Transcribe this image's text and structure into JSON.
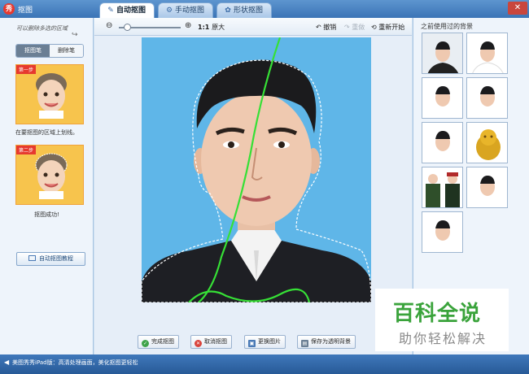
{
  "window": {
    "title": "抠图",
    "close_symbol": "✕"
  },
  "tabs": [
    {
      "label": "自动抠图",
      "icon": "brush-icon",
      "active": true
    },
    {
      "label": "手动抠图",
      "icon": "gear-icon",
      "active": false
    },
    {
      "label": "形状抠图",
      "icon": "shape-icon",
      "active": false
    }
  ],
  "left_panel": {
    "hint": "可以删除多选的区域",
    "tools": [
      "抠图笔",
      "删除笔"
    ],
    "step1": {
      "badge": "第一步",
      "caption": "在要抠图的区域上划线。"
    },
    "step2": {
      "badge": "第二步",
      "caption": "抠图成功!"
    },
    "tutorial_label": "自动抠图教程"
  },
  "toolbar": {
    "zoom_ratio": "1:1",
    "original_label": "原大",
    "undo_label": "撤销",
    "redo_label": "重做",
    "restart_label": "重新开始",
    "zoom_level": 0.13
  },
  "actions": {
    "finish": "完成抠图",
    "cancel": "取消抠图",
    "replace": "更换图片",
    "save_transparent": "保存为透明背景"
  },
  "right_panel": {
    "title": "之前使用过的背景",
    "thumbnails": [
      "portrait-blue-bg",
      "portrait-white-bg",
      "portrait-white-bg",
      "portrait-white-bg",
      "portrait-white-bg",
      "golden-lion-statue",
      "soldiers-photo",
      "portrait-white-bg",
      "portrait-white-bg"
    ]
  },
  "statusbar": {
    "text": "美图秀秀iPad版：高清处理画面，美化抠图更轻松"
  },
  "watermark": {
    "main": "百科全说",
    "sub": "助你轻松解决"
  },
  "colors": {
    "sky_blue_bg": "#5fb6e8",
    "title_bar": "#3b74b6",
    "selection_line": "#36e036",
    "watermark_green": "#3aa33b"
  }
}
